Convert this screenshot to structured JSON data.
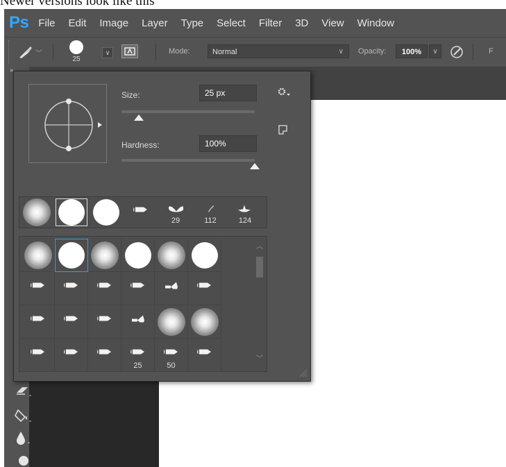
{
  "caption": "Newer versions look like this",
  "app": {
    "logo": "Ps",
    "accent": "#31a8ff"
  },
  "menu": [
    "File",
    "Edit",
    "Image",
    "Layer",
    "Type",
    "Select",
    "Filter",
    "3D",
    "View",
    "Window"
  ],
  "options_bar": {
    "brush_size": "25",
    "mode_label": "Mode:",
    "mode_value": "Normal",
    "opacity_label": "Opacity:",
    "opacity_value": "100%",
    "cutoff_label": "F"
  },
  "brush_panel": {
    "size_label": "Size:",
    "size_value": "25 px",
    "size_fraction": 0.13,
    "hardness_label": "Hardness:",
    "hardness_value": "100%",
    "hardness_fraction": 1.0,
    "recent_presets": [
      {
        "kind": "soft",
        "label": ""
      },
      {
        "kind": "hard",
        "label": "",
        "selected": true
      },
      {
        "kind": "hard",
        "label": ""
      },
      {
        "kind": "tip",
        "label": ""
      },
      {
        "kind": "butterfly",
        "label": "29"
      },
      {
        "kind": "stroke",
        "label": "112"
      },
      {
        "kind": "leaf",
        "label": "124"
      }
    ],
    "grid": [
      [
        {
          "kind": "soft",
          "label": ""
        },
        {
          "kind": "hard",
          "label": "",
          "selected": true
        },
        {
          "kind": "soft",
          "label": ""
        },
        {
          "kind": "hard",
          "label": ""
        },
        {
          "kind": "soft",
          "label": ""
        },
        {
          "kind": "hard",
          "label": ""
        }
      ],
      [
        {
          "kind": "tip",
          "label": ""
        },
        {
          "kind": "tip",
          "label": ""
        },
        {
          "kind": "tip",
          "label": ""
        },
        {
          "kind": "tip",
          "label": ""
        },
        {
          "kind": "fan",
          "label": ""
        },
        {
          "kind": "tip",
          "label": ""
        }
      ],
      [
        {
          "kind": "tip",
          "label": ""
        },
        {
          "kind": "tip",
          "label": ""
        },
        {
          "kind": "tip",
          "label": ""
        },
        {
          "kind": "fan",
          "label": ""
        },
        {
          "kind": "soft",
          "label": ""
        },
        {
          "kind": "soft",
          "label": ""
        }
      ],
      [
        {
          "kind": "tip",
          "label": ""
        },
        {
          "kind": "tip",
          "label": ""
        },
        {
          "kind": "tip",
          "label": ""
        },
        {
          "kind": "tip",
          "label": "25"
        },
        {
          "kind": "tip",
          "label": "50"
        },
        {
          "kind": "tip",
          "label": ""
        }
      ]
    ]
  },
  "colors": {
    "panel_bg": "#535353",
    "selection": "#2f9fe0",
    "canvas": "#ffffff",
    "workarea": "#282828"
  }
}
